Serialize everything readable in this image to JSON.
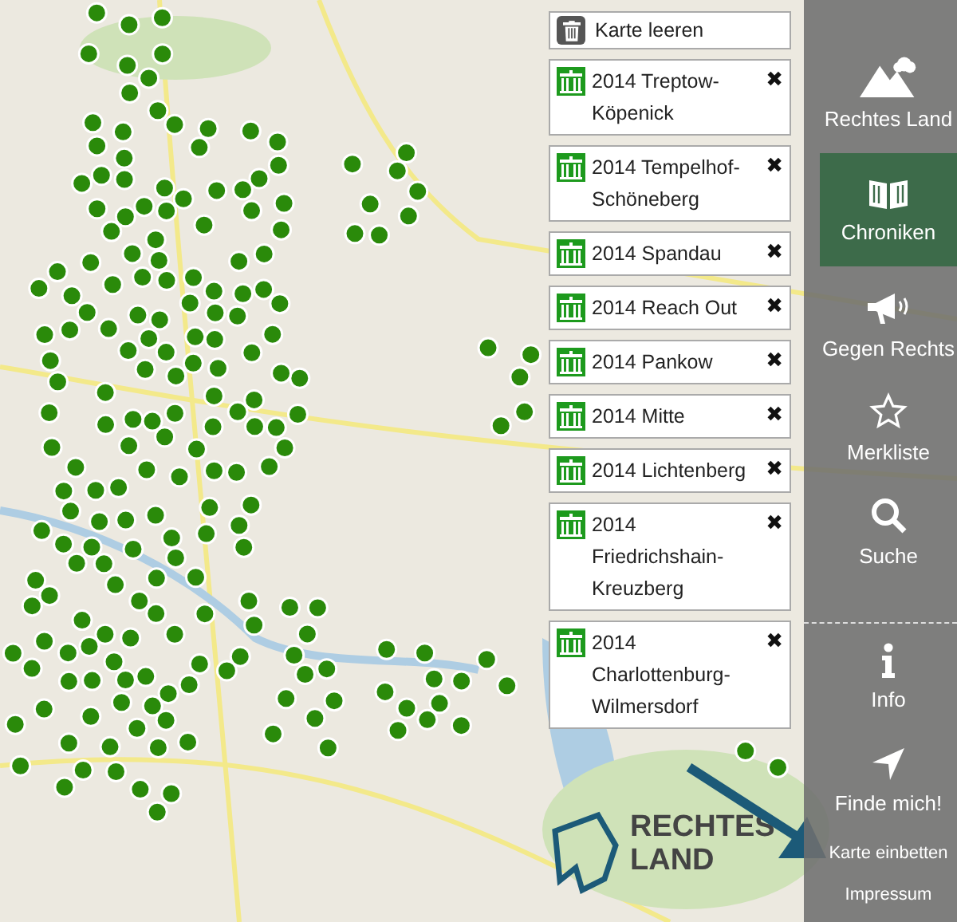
{
  "map": {
    "logo": {
      "line_1": "RECHTES",
      "line_2": "LAND"
    }
  },
  "layers": {
    "clear_button": "Karte leeren",
    "items": [
      {
        "label": "2014 Treptow-Köpenick",
        "remove": "✖"
      },
      {
        "label": "2014 Tempelhof-Schöneberg",
        "remove": "✖"
      },
      {
        "label": "2014 Spandau",
        "remove": "✖"
      },
      {
        "label": "2014 Reach Out",
        "remove": "✖"
      },
      {
        "label": "2014 Pankow",
        "remove": "✖"
      },
      {
        "label": "2014 Mitte",
        "remove": "✖"
      },
      {
        "label": "2014 Lichtenberg",
        "remove": "✖"
      },
      {
        "label": "2014 Friedrichshain-Kreuzberg",
        "remove": "✖"
      },
      {
        "label": "2014 Charlottenburg-Wilmersdorf",
        "remove": "✖"
      }
    ]
  },
  "sidebar": {
    "main": [
      {
        "label": "Rechtes Land",
        "kind": "mountains",
        "selected": false
      },
      {
        "label": "Chroniken",
        "kind": "book",
        "selected": true
      },
      {
        "label": "Gegen Rechts",
        "kind": "megaphone",
        "selected": false
      },
      {
        "label": "Merkliste",
        "kind": "star",
        "selected": false
      },
      {
        "label": "Suche",
        "kind": "search",
        "selected": false
      }
    ],
    "extra": [
      {
        "label": "Info",
        "kind": "info"
      },
      {
        "label": "Finde mich!",
        "kind": "locate"
      },
      {
        "label": "Karte einbetten",
        "kind": "text"
      },
      {
        "label": "Impressum",
        "kind": "text"
      }
    ]
  }
}
